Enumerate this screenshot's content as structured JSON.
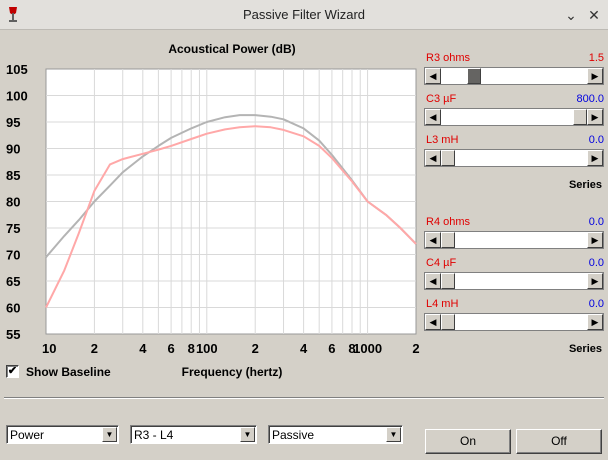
{
  "window": {
    "title": "Passive Filter Wizard"
  },
  "chart_data": {
    "type": "line",
    "title": "Acoustical Power (dB)",
    "xlabel": "Frequency (hertz)",
    "ylabel": "",
    "x_scale": "log",
    "xlim": [
      10,
      2000
    ],
    "ylim": [
      55,
      105
    ],
    "y_ticks": [
      105,
      100,
      95,
      90,
      85,
      80,
      75,
      70,
      65,
      60,
      55
    ],
    "x_tick_labels": [
      {
        "x": 10,
        "label": "10"
      },
      {
        "x": 20,
        "label": "2"
      },
      {
        "x": 40,
        "label": "4"
      },
      {
        "x": 60,
        "label": "6"
      },
      {
        "x": 80,
        "label": "8"
      },
      {
        "x": 100,
        "label": "100"
      },
      {
        "x": 200,
        "label": "2"
      },
      {
        "x": 400,
        "label": "4"
      },
      {
        "x": 600,
        "label": "6"
      },
      {
        "x": 800,
        "label": "8"
      },
      {
        "x": 1000,
        "label": "1000"
      },
      {
        "x": 2000,
        "label": "2"
      }
    ],
    "grid": true,
    "series": [
      {
        "color": "#b4b4b4",
        "x": [
          10,
          13,
          16,
          20,
          25,
          30,
          40,
          50,
          60,
          80,
          100,
          130,
          160,
          200,
          250,
          300,
          400,
          500,
          600,
          800,
          1000,
          1300,
          1600,
          2000
        ],
        "y": [
          69.5,
          73.5,
          76.5,
          80,
          83,
          85.5,
          88.5,
          90.5,
          92,
          93.8,
          95,
          95.9,
          96.3,
          96.3,
          96,
          95.5,
          93.8,
          91.5,
          88.8,
          84,
          80,
          77.5,
          75,
          72
        ]
      },
      {
        "color": "#ffa8a8",
        "x": [
          10,
          13,
          16,
          20,
          25,
          30,
          40,
          50,
          60,
          80,
          100,
          130,
          160,
          200,
          250,
          300,
          400,
          500,
          600,
          800,
          1000,
          1300,
          1600,
          2000
        ],
        "y": [
          60,
          67,
          74,
          82,
          87,
          88,
          89,
          89.8,
          90.5,
          91.8,
          92.8,
          93.6,
          94,
          94.2,
          94,
          93.5,
          92.3,
          90.5,
          88.2,
          83.8,
          80,
          77.5,
          75,
          72
        ]
      }
    ]
  },
  "show_baseline": {
    "label": "Show Baseline",
    "checked": true,
    "check_glyph": "✔"
  },
  "components": [
    {
      "name": "R3  ohms",
      "value": "1.5",
      "value_color": "red",
      "position": 0.2
    },
    {
      "name": "C3  µF",
      "value": "800.0",
      "value_color": "blue",
      "position": 1.0
    },
    {
      "name": "L3  mH",
      "value": "0.0",
      "value_color": "blue",
      "position": 0.0
    },
    {
      "name": "R4  ohms",
      "value": "0.0",
      "value_color": "blue",
      "position": 0.0
    },
    {
      "name": "C4  µF",
      "value": "0.0",
      "value_color": "blue",
      "position": 0.0
    },
    {
      "name": "L4  mH",
      "value": "0.0",
      "value_color": "blue",
      "position": 0.0
    }
  ],
  "series_labels": [
    "Series",
    "Series"
  ],
  "controls": {
    "mode_select": "Power",
    "range_select": "R3 - L4",
    "type_select": "Passive",
    "on_label": "On",
    "off_label": "Off"
  }
}
